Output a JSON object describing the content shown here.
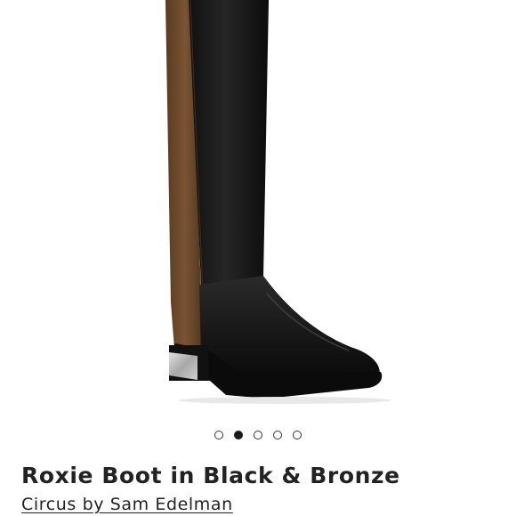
{
  "product": {
    "title": "Roxie Boot in Black & Bronze",
    "brand": "Circus by Sam Edelman"
  },
  "carousel": {
    "total": 5,
    "active_index": 1
  },
  "colors": {
    "boot_black": "#141414",
    "bronze_panel": "#6e4a2c",
    "heel_plate": "#b9b9b9",
    "text": "#222222"
  }
}
